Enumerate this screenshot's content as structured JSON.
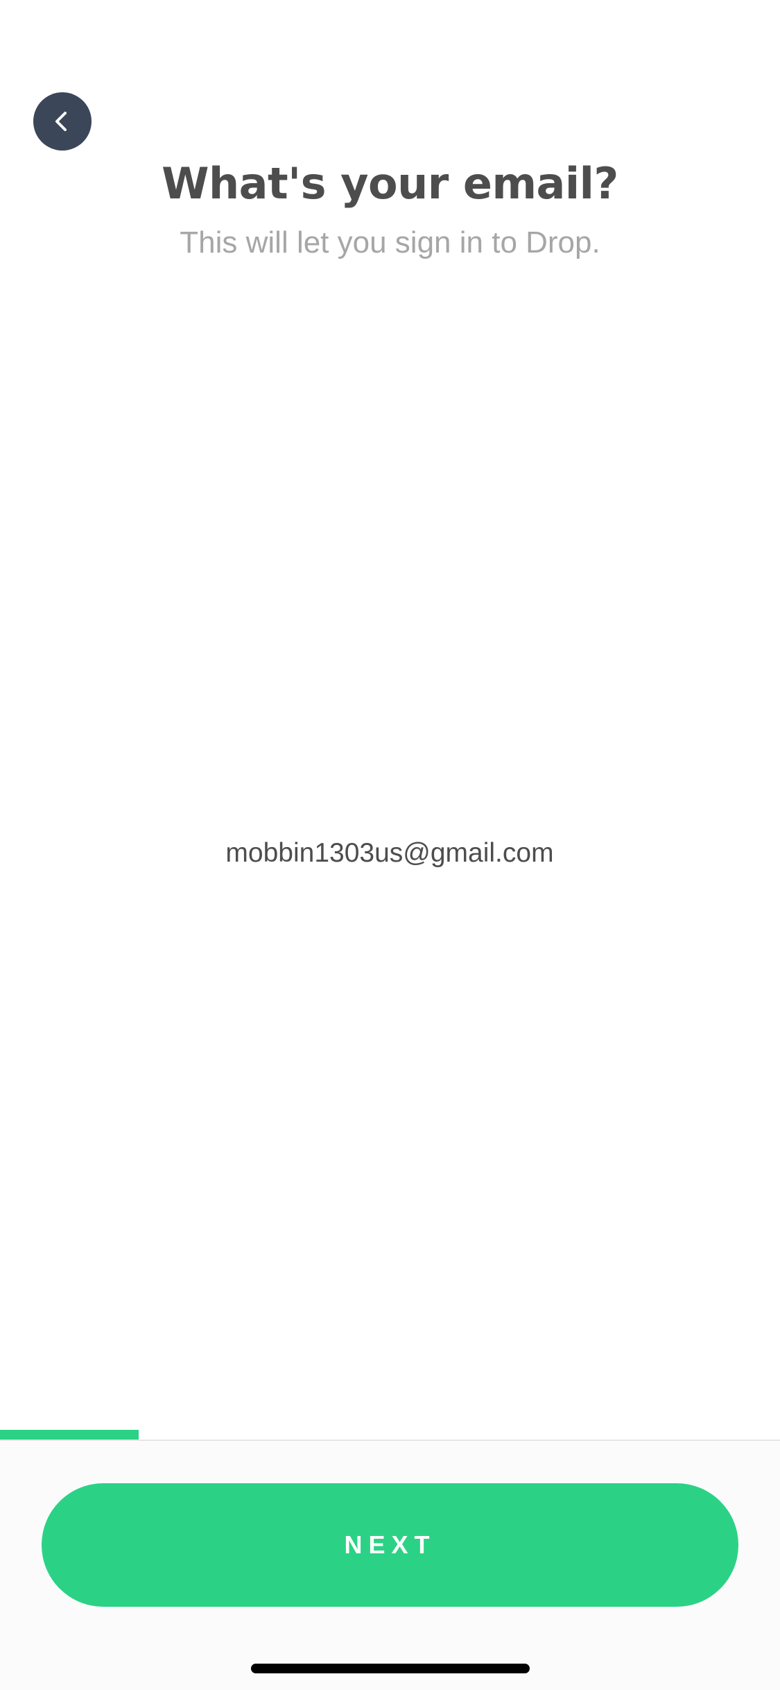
{
  "header": {
    "back_icon": "chevron-left-icon",
    "title": "What's your email?",
    "subtitle": "This will let you sign in to Drop."
  },
  "form": {
    "email_value": "mobbin1303us@gmail.com"
  },
  "progress": {
    "fraction": 0.1778,
    "color": "#2bd285"
  },
  "footer": {
    "next_label": "NEXT",
    "button_color": "#2bd285"
  },
  "colors": {
    "back_button_bg": "#3b4659",
    "title": "#4d4d4d",
    "subtitle": "#a6a6a6"
  }
}
